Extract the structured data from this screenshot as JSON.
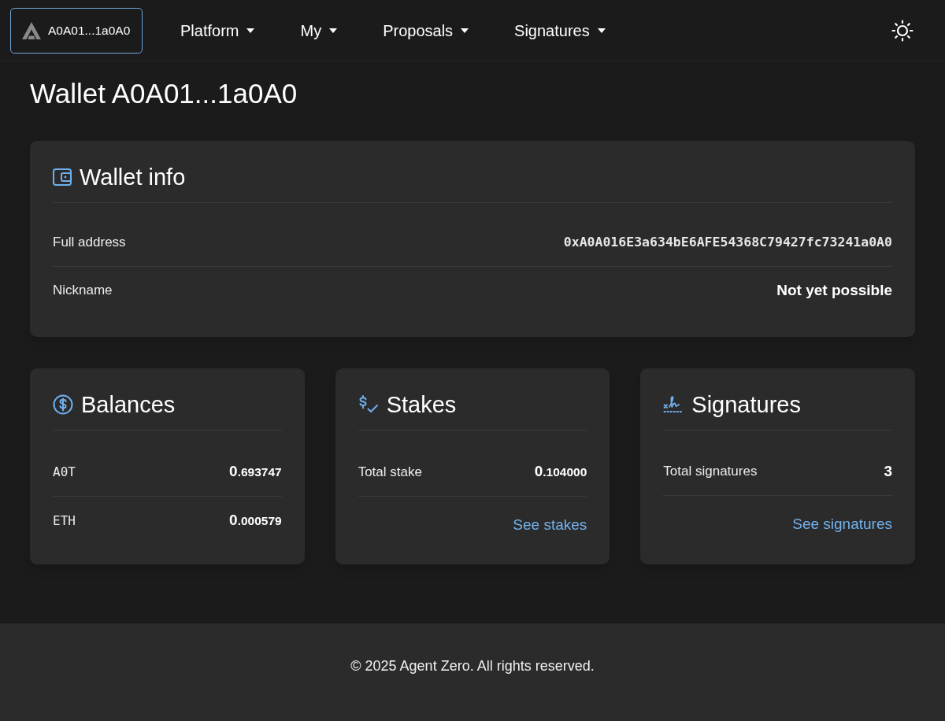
{
  "navbar": {
    "brand": "A0A01...1a0A0",
    "menus": [
      {
        "label": "Platform"
      },
      {
        "label": "My"
      },
      {
        "label": "Proposals"
      },
      {
        "label": "Signatures"
      }
    ]
  },
  "page_title": "Wallet A0A01...1a0A0",
  "wallet_info": {
    "title": "Wallet info",
    "rows": [
      {
        "kind": "mono",
        "label": "Full address",
        "value": "0xA0A016E3a634bE6AFE54368C79427fc73241a0A0"
      },
      {
        "kind": "bold",
        "label": "Nickname",
        "value": "Not yet possible"
      }
    ]
  },
  "cards": [
    {
      "kind": "balances",
      "title": "Balances",
      "rows": [
        {
          "kind": "token",
          "label": "A0T",
          "whole": "0",
          "fraction": ".693747"
        },
        {
          "kind": "token",
          "label": "ETH",
          "whole": "0",
          "fraction": ".000579"
        }
      ]
    },
    {
      "kind": "stakes",
      "title": "Stakes",
      "rows": [
        {
          "kind": "amount",
          "label": "Total stake",
          "whole": "0",
          "fraction": ".104000"
        }
      ],
      "link": "See stakes"
    },
    {
      "kind": "signatures",
      "title": "Signatures",
      "rows": [
        {
          "kind": "count",
          "label": "Total signatures",
          "value": "3"
        }
      ],
      "link": "See signatures"
    }
  ],
  "footer": "© 2025 Agent Zero. All rights reserved."
}
